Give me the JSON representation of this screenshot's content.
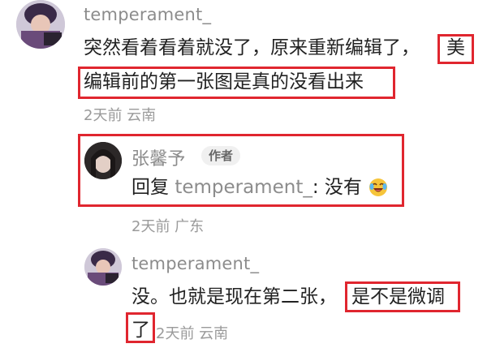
{
  "comment": {
    "username": "temperament_",
    "text_line1": "突然看着看着就没了，原来重新编辑了，",
    "text_highlight1": "美",
    "text_highlight2": "编辑前的第一张图是真的没看出来",
    "meta": "2天前 云南"
  },
  "reply1": {
    "username": "张馨予",
    "badge": "作者",
    "reply_prefix": "回复",
    "reply_target": "temperament_",
    "reply_text": ": 没有",
    "meta": "2天前 广东"
  },
  "reply2": {
    "username": "temperament_",
    "text_line1": "没。也就是现在第二张，",
    "text_highlight1": "是不是微调",
    "text_highlight2": "了",
    "meta": "2天前 云南"
  },
  "colors": {
    "highlight_box": "#e0262f",
    "username": "#8c8c8c",
    "meta": "#9a9a9a"
  },
  "icons": {
    "emoji": "crying-laughing-emoji-icon"
  }
}
